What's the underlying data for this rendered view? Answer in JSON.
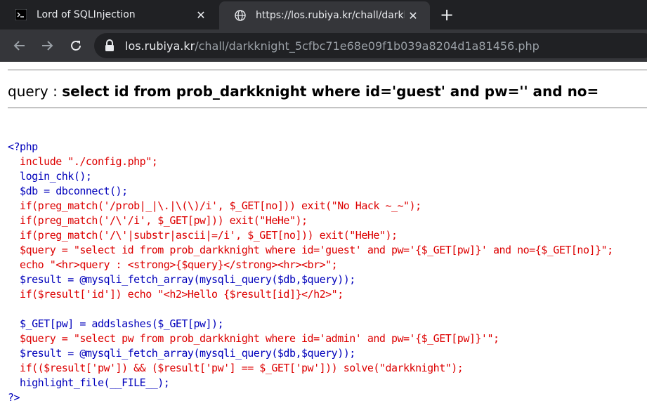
{
  "browser": {
    "tabs": [
      {
        "title": "Lord of SQLInjection",
        "icon": "terminal-icon",
        "active": false
      },
      {
        "title": "https://los.rubiya.kr/chall/darkkn",
        "icon": "globe-icon",
        "active": true
      }
    ],
    "new_tab_symbol": "+",
    "url_host": "los.rubiya.kr",
    "url_path": "/chall/darkknight_5cfbc71e68e09f1b039a8204d1a81456.php"
  },
  "page": {
    "query_prefix": "query : ",
    "query_sql": "select id from prob_darkknight where id='guest' and pw='' and no="
  },
  "source": {
    "lines": [
      {
        "text": "<?php",
        "color": "#0000bb"
      },
      {
        "text": "  include \"./config.php\";",
        "color": "#dd0000"
      },
      {
        "text": "  login_chk();",
        "color": "#0000bb"
      },
      {
        "text": "  $db = dbconnect();",
        "color": "#0000bb"
      },
      {
        "text": "  if(preg_match('/prob|_|\\.|\\(\\)/i', $_GET[no])) exit(\"No Hack ~_~\");",
        "color": "#dd0000"
      },
      {
        "text": "  if(preg_match('/\\'/i', $_GET[pw])) exit(\"HeHe\");",
        "color": "#dd0000"
      },
      {
        "text": "  if(preg_match('/\\'|substr|ascii|=/i', $_GET[no])) exit(\"HeHe\");",
        "color": "#dd0000"
      },
      {
        "text": "  $query = \"select id from prob_darkknight where id='guest' and pw='{$_GET[pw]}' and no={$_GET[no]}\";",
        "color": "#dd0000"
      },
      {
        "text": "  echo \"<hr>query : <strong>{$query}</strong><hr><br>\";",
        "color": "#dd0000"
      },
      {
        "text": "  $result = @mysqli_fetch_array(mysqli_query($db,$query));",
        "color": "#0000bb"
      },
      {
        "text": "  if($result['id']) echo \"<h2>Hello {$result[id]}</h2>\";",
        "color": "#dd0000"
      },
      {
        "text": "",
        "color": "#000000"
      },
      {
        "text": "  $_GET[pw] = addslashes($_GET[pw]);",
        "color": "#0000bb"
      },
      {
        "text": "  $query = \"select pw from prob_darkknight where id='admin' and pw='{$_GET[pw]}'\";",
        "color": "#dd0000"
      },
      {
        "text": "  $result = @mysqli_fetch_array(mysqli_query($db,$query));",
        "color": "#0000bb"
      },
      {
        "text": "  if(($result['pw']) && ($result['pw'] == $_GET['pw'])) solve(\"darkknight\");",
        "color": "#dd0000"
      },
      {
        "text": "  highlight_file(__FILE__);",
        "color": "#0000bb"
      },
      {
        "text": "?>",
        "color": "#0000bb"
      }
    ]
  }
}
